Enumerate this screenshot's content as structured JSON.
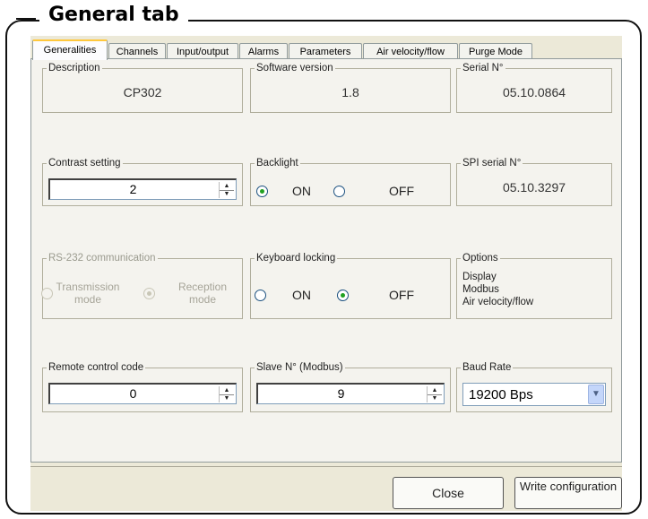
{
  "frame": {
    "title": "General tab"
  },
  "tabs": [
    {
      "label": "Generalities",
      "active": true
    },
    {
      "label": "Channels"
    },
    {
      "label": "Input/output"
    },
    {
      "label": "Alarms"
    },
    {
      "label": "Parameters"
    },
    {
      "label": "Air velocity/flow"
    },
    {
      "label": "Purge Mode"
    }
  ],
  "description": {
    "label": "Description",
    "value": "CP302"
  },
  "software_version": {
    "label": "Software version",
    "value": "1.8"
  },
  "serial": {
    "label": "Serial N°",
    "value": "05.10.0864"
  },
  "contrast": {
    "label": "Contrast setting",
    "value": "2"
  },
  "backlight": {
    "label": "Backlight",
    "on_label": "ON",
    "off_label": "OFF",
    "selected": "ON"
  },
  "spi_serial": {
    "label": "SPI serial N°",
    "value": "05.10.3297"
  },
  "rs232": {
    "label": "RS-232 communication",
    "transmission": "Transmission mode",
    "reception": "Reception mode",
    "selected": "Reception",
    "disabled": true
  },
  "keyboard_locking": {
    "label": "Keyboard locking",
    "on_label": "ON",
    "off_label": "OFF",
    "selected": "OFF"
  },
  "options": {
    "label": "Options",
    "items": [
      "Display",
      "Modbus",
      "Air velocity/flow"
    ]
  },
  "remote_code": {
    "label": "Remote control code",
    "value": "0"
  },
  "slave": {
    "label": "Slave N° (Modbus)",
    "value": "9"
  },
  "baud": {
    "label": "Baud Rate",
    "value": "19200 Bps"
  },
  "buttons": {
    "close": "Close",
    "write": "Write configuration"
  }
}
